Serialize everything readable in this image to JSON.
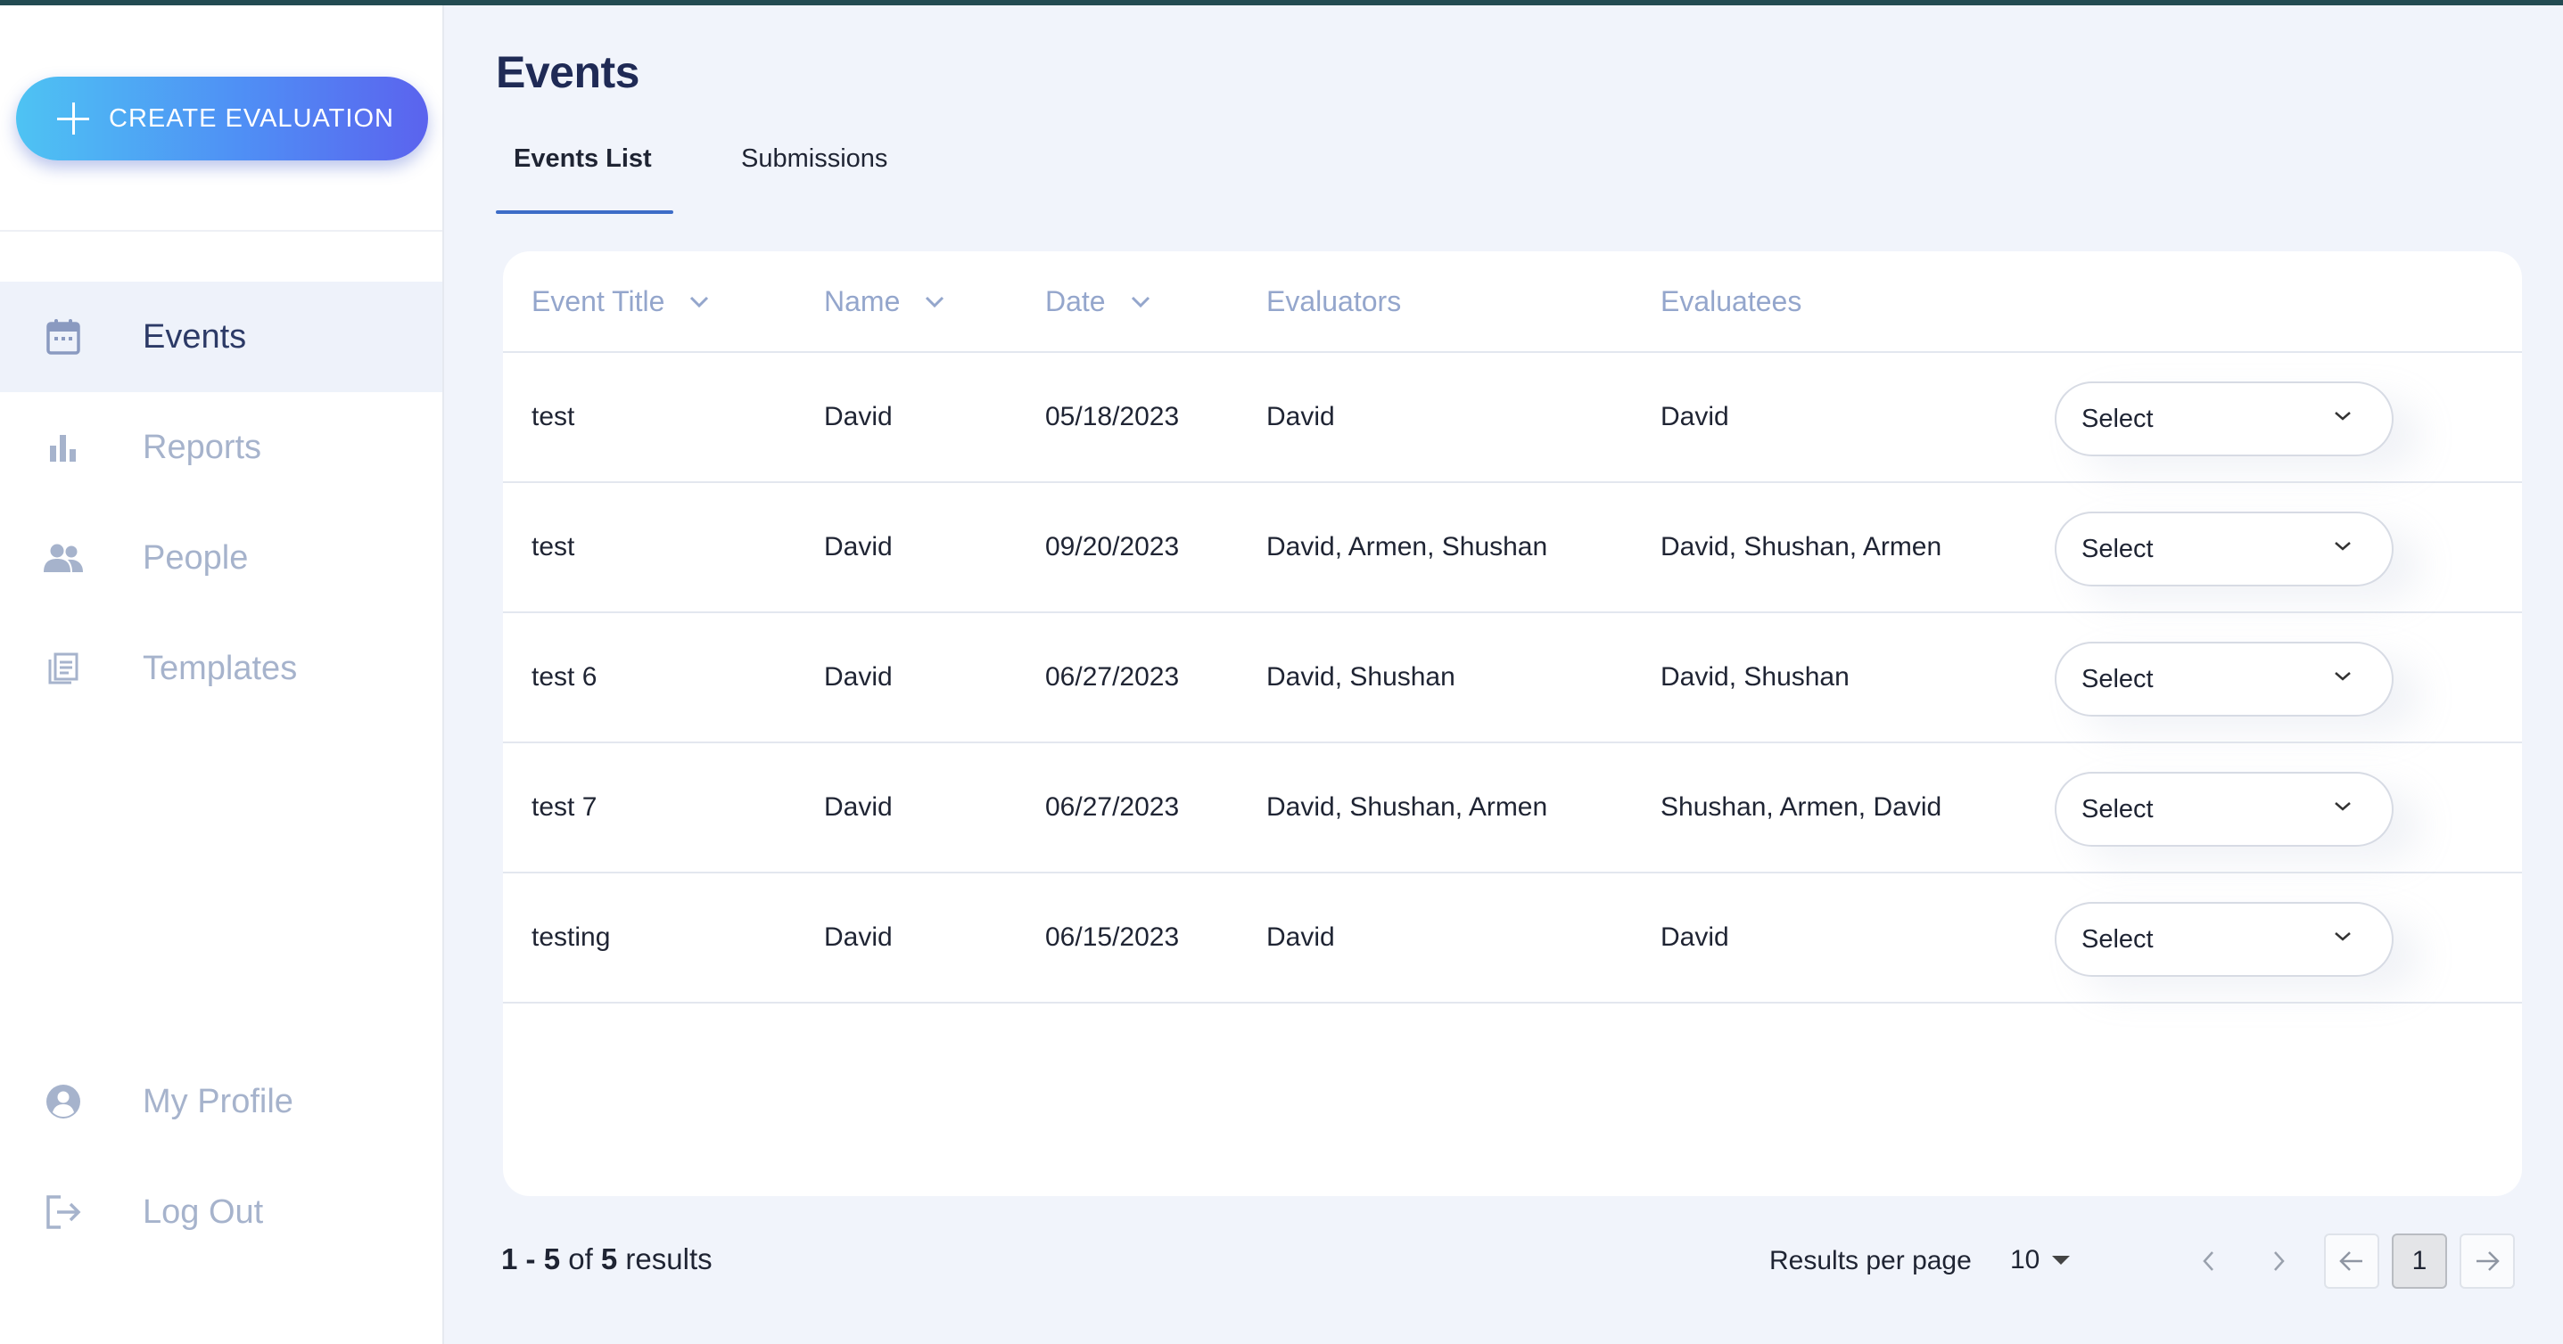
{
  "sidebar": {
    "create_button": "CREATE EVALUATION",
    "nav": [
      {
        "label": "Events",
        "icon": "calendar-icon"
      },
      {
        "label": "Reports",
        "icon": "bar-chart-icon"
      },
      {
        "label": "People",
        "icon": "people-icon"
      },
      {
        "label": "Templates",
        "icon": "template-icon"
      }
    ],
    "bottom": [
      {
        "label": "My Profile",
        "icon": "profile-icon"
      },
      {
        "label": "Log Out",
        "icon": "logout-icon"
      }
    ]
  },
  "page": {
    "title": "Events",
    "tabs": [
      "Events List",
      "Submissions"
    ],
    "active_tab": "Events List"
  },
  "table": {
    "columns": [
      "Event Title",
      "Name",
      "Date",
      "Evaluators",
      "Evaluatees"
    ],
    "rows": [
      {
        "title": "test",
        "name": "David",
        "date": "05/18/2023",
        "evaluators": "David",
        "evaluatees": "David",
        "action": "Select"
      },
      {
        "title": "test",
        "name": "David",
        "date": "09/20/2023",
        "evaluators": "David, Armen, Shushan",
        "evaluatees": "David, Shushan, Armen",
        "action": "Select"
      },
      {
        "title": "test 6",
        "name": "David",
        "date": "06/27/2023",
        "evaluators": "David, Shushan",
        "evaluatees": "David, Shushan",
        "action": "Select"
      },
      {
        "title": "test 7",
        "name": "David",
        "date": "06/27/2023",
        "evaluators": "David, Shushan, Armen",
        "evaluatees": "Shushan, Armen, David",
        "action": "Select"
      },
      {
        "title": "testing",
        "name": "David",
        "date": "06/15/2023",
        "evaluators": "David",
        "evaluatees": "David",
        "action": "Select"
      }
    ]
  },
  "footer": {
    "range_start": "1",
    "range_sep": " - ",
    "range_end": "5",
    "of_text": " of ",
    "total": "5",
    "results_word": " results",
    "per_page_label": "Results per page",
    "per_page_value": "10",
    "current_page": "1"
  },
  "colors": {
    "accent": "#3d6cc7",
    "title": "#1f2a55",
    "muted_nav": "#a6b3cc",
    "header_text": "#94a6cc",
    "background": "#f1f4fb"
  }
}
